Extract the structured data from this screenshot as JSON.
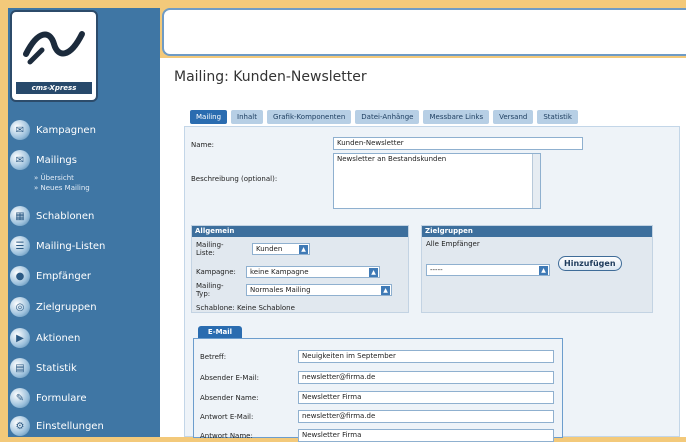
{
  "app": {
    "logo_text": "cms-Xpress"
  },
  "sidebar": {
    "items": [
      {
        "label": "Kampagnen",
        "icon": "campaign-icon"
      },
      {
        "label": "Mailings",
        "icon": "mail-icon"
      },
      {
        "label": "Schablonen",
        "icon": "template-icon"
      },
      {
        "label": "Mailing-Listen",
        "icon": "list-icon"
      },
      {
        "label": "Empfänger",
        "icon": "recipient-icon"
      },
      {
        "label": "Zielgruppen",
        "icon": "target-group-icon"
      },
      {
        "label": "Aktionen",
        "icon": "action-icon"
      },
      {
        "label": "Statistik",
        "icon": "statistics-icon"
      },
      {
        "label": "Formulare",
        "icon": "form-icon"
      },
      {
        "label": "Einstellungen",
        "icon": "settings-icon"
      }
    ],
    "subitems": [
      "» Übersicht",
      "» Neues Mailing"
    ]
  },
  "main": {
    "title": "Mailing: Kunden-Newsletter",
    "tabs": [
      "Mailing",
      "Inhalt",
      "Grafik-Komponenten",
      "Datei-Anhänge",
      "Messbare Links",
      "Versand",
      "Statistik"
    ],
    "name_label": "Name:",
    "name_value": "Kunden-Newsletter",
    "desc_label": "Beschreibung (optional):",
    "desc_value": "Newsletter an Bestandskunden",
    "general": {
      "header": "Allgemein",
      "list_label": "Mailing-Liste:",
      "list_value": "Kunden",
      "campaign_label": "Kampagne:",
      "campaign_value": "keine Kampagne",
      "type_label": "Mailing-Typ:",
      "type_value": "Normales Mailing",
      "template_text": "Schablone: Keine Schablone"
    },
    "targets": {
      "header": "Zielgruppen",
      "all_text": "Alle Empfänger",
      "select_value": "-----",
      "add_button": "Hinzufügen"
    },
    "email": {
      "tab_label": "E-Mail",
      "subject_label": "Betreff:",
      "subject_value": "Neuigkeiten im September",
      "sender_email_label": "Absender E-Mail:",
      "sender_email_value": "newsletter@firma.de",
      "sender_name_label": "Absender Name:",
      "sender_name_value": "Newsletter Firma",
      "reply_email_label": "Antwort E-Mail:",
      "reply_email_value": "newsletter@firma.de",
      "reply_name_label": "Antwort Name:",
      "reply_name_value": "Newsletter Firma"
    }
  }
}
